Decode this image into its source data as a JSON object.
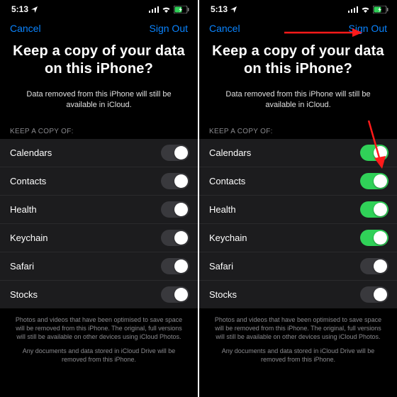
{
  "status": {
    "time": "5:13",
    "loc_icon": "location-icon",
    "signal_icon": "cell-signal-icon",
    "wifi_icon": "wifi-icon",
    "battery_icon": "battery-charging-icon"
  },
  "nav": {
    "cancel": "Cancel",
    "signout": "Sign Out"
  },
  "title": "Keep a copy of your data on this iPhone?",
  "subtitle": "Data removed from this iPhone will still be available in iCloud.",
  "section_header": "KEEP A COPY OF:",
  "items": [
    {
      "label": "Calendars"
    },
    {
      "label": "Contacts"
    },
    {
      "label": "Health"
    },
    {
      "label": "Keychain"
    },
    {
      "label": "Safari"
    },
    {
      "label": "Stocks"
    }
  ],
  "left_states": [
    false,
    false,
    false,
    false,
    false,
    false
  ],
  "right_states": [
    true,
    true,
    true,
    true,
    false,
    false
  ],
  "footer": {
    "p1": "Photos and videos that have been optimised to save space will be removed from this iPhone. The original, full versions will still be available on other devices using iCloud Photos.",
    "p2": "Any documents and data stored in iCloud Drive will be removed from this iPhone."
  },
  "colors": {
    "link": "#0a84ff",
    "toggle_on": "#30d158",
    "arrow": "#ff1a1a"
  }
}
